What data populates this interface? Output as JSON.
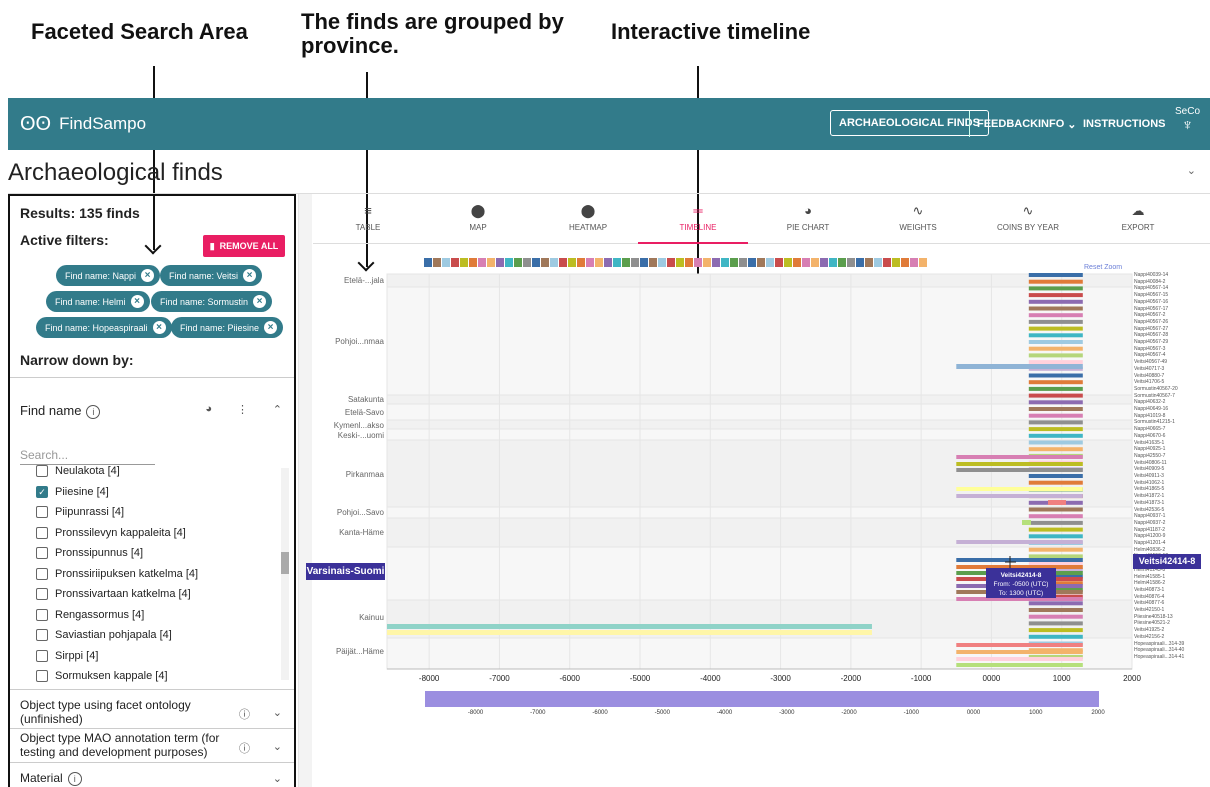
{
  "annotations": {
    "facets": "Faceted Search Area",
    "provinces": "The finds are grouped by province.",
    "timeline": "Interactive timeline"
  },
  "topbar": {
    "app_name": "FindSampo",
    "nav": [
      "ARCHAEOLOGICAL FINDS",
      "FEEDBACK",
      "INFO",
      "INSTRUCTIONS"
    ],
    "brand": "SeCo",
    "color": "#327b8a"
  },
  "page": {
    "title": "Archaeological finds"
  },
  "left": {
    "results": "Results: 135 finds",
    "active_filters": "Active filters:",
    "remove_all": "REMOVE ALL",
    "chips": [
      "Find name: Nappi",
      "Find name: Veitsi",
      "Find name: Helmi",
      "Find name: Sormustin",
      "Find name: Hopeaspiraali",
      "Find name: Piiesine"
    ],
    "narrow": "Narrow down by:",
    "facet_name": "Find name",
    "search_placeholder": "Search...",
    "items": [
      {
        "label": "Neulakota [4]",
        "checked": false
      },
      {
        "label": "Piiesine [4]",
        "checked": true
      },
      {
        "label": "Piipunrassi [4]",
        "checked": false
      },
      {
        "label": "Pronssilevyn kappaleita [4]",
        "checked": false
      },
      {
        "label": "Pronssipunnus [4]",
        "checked": false
      },
      {
        "label": "Pronssiriipuksen katkelma [4]",
        "checked": false
      },
      {
        "label": "Pronssivartaan katkelma [4]",
        "checked": false
      },
      {
        "label": "Rengassormus [4]",
        "checked": false
      },
      {
        "label": "Saviastian pohjapala [4]",
        "checked": false
      },
      {
        "label": "Sirppi [4]",
        "checked": false
      },
      {
        "label": "Sormuksen kappale [4]",
        "checked": false
      }
    ],
    "facets": [
      "Object type using facet ontology (unfinished)",
      "Object type MAO annotation term (for testing and development purposes)",
      "Material"
    ]
  },
  "tabs": [
    {
      "label": "TABLE",
      "icon": "≡"
    },
    {
      "label": "MAP",
      "icon": "⬤"
    },
    {
      "label": "HEATMAP",
      "icon": "⬤"
    },
    {
      "label": "TIMELINE",
      "icon": "═"
    },
    {
      "label": "PIE CHART",
      "icon": "◕"
    },
    {
      "label": "WEIGHTS",
      "icon": "∿"
    },
    {
      "label": "COINS BY YEAR",
      "icon": "∿"
    },
    {
      "label": "EXPORT",
      "icon": "☁"
    }
  ],
  "timeline": {
    "reset_zoom": "Reset Zoom",
    "provinces": [
      "Etelä-...jala",
      "Pohjoi...nmaa",
      "Satakunta",
      "Etelä-Savo",
      "Kymenl...akso",
      "Keski-...uomi",
      "Pirkanmaa",
      "Pohjoi...Savo",
      "Kanta-Häme",
      "Varsinais-Suomi",
      "Kainuu",
      "Päijät...Häme"
    ],
    "axis": [
      "-8000",
      "-7000",
      "-6000",
      "-5000",
      "-4000",
      "-3000",
      "-2000",
      "-1000",
      "0000",
      "1000",
      "2000"
    ],
    "overview_axis": [
      "-8000",
      "-7000",
      "-6000",
      "-5000",
      "-4000",
      "-3000",
      "-2000",
      "-1000",
      "0000",
      "1000",
      "2000"
    ],
    "tooltip": {
      "name": "Veitsi42414-8",
      "from": "From: -0500 (UTC)",
      "to": "To: 1300 (UTC)"
    },
    "highlight_province": "Varsinais-Suomi",
    "highlight_item": "Veitsi42414-8",
    "right_labels": [
      "Nappi40039-14",
      "Nappi40084-2",
      "Nappi40567-14",
      "Nappi40567-15",
      "Nappi40567-16",
      "Nappi40567-17",
      "Nappi40567-2",
      "Nappi40567-26",
      "Nappi40567-27",
      "Nappi40567-28",
      "Nappi40567-29",
      "Nappi40567-3",
      "Nappi40567-4",
      "Veitsi40567-49",
      "Veitsi40717-3",
      "Veitsi40880-7",
      "Veitsi41706-5",
      "Sormustin40567-20",
      "Sormustin40567-7",
      "Nappi40632-2",
      "Nappi40649-16",
      "Nappi41019-8",
      "Sormustin41215-1",
      "Nappi40665-7",
      "Nappi40670-6",
      "Veitsi41635-1",
      "Nappi40925-1",
      "Nappi42550-7",
      "Veitsi40806-11",
      "Veitsi40909-5",
      "Veitsi40911-3",
      "Veitsi41062-1",
      "Veitsi41865-5",
      "Veitsi41872-1",
      "Veitsi41873-1",
      "Veitsi42536-5",
      "Nappi40937-1",
      "Nappi40937-2",
      "Nappi41187-2",
      "Nappi41200-9",
      "Nappi41201-4",
      "Helmi40836-2",
      "Nappi41550-12",
      "Helmi41242-3",
      "Helmi41243-8",
      "Helmi41585-1",
      "Helmi41586-2",
      "Veitsi40873-1",
      "Veitsi40876-4",
      "Veitsi40877-6",
      "Veitsi42150-1",
      "Piiesine40518-13",
      "Piiesine40521-2",
      "Veitsi41925-2",
      "Veitsi42156-2",
      "Hopeaspiraali...314-39",
      "Hopeaspiraali...314-40",
      "Hopeaspiraali...314-41"
    ]
  }
}
